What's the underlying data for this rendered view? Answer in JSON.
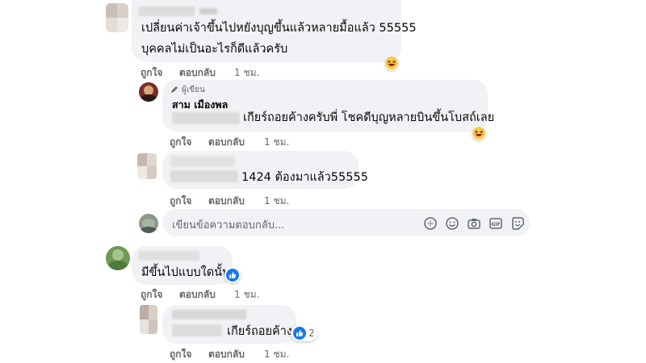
{
  "comments": [
    {
      "text_line1": "เปลี่ยนค่าเจ้าขึ้นไปหยังบุญขึ้นแล้วหลายมื้อแล้ว 55555",
      "text_line2": "บุคคลไม่เป็นอะไรก็ดีแล้วครับ",
      "reaction": "laughing-emoji",
      "actions": {
        "like": "ถูกใจ",
        "reply": "ตอบกลับ",
        "time": "1 ชม."
      }
    },
    {
      "author_badge": "ผู้เขียน",
      "author_name": "สาม เมืองพล",
      "text_line1": "เกียร์ถอยค้างครับพี่ โชคดีบุญหลายบินขึ้นโบสถ์เลย",
      "reaction": "laughing-emoji",
      "actions": {
        "like": "ถูกใจ",
        "reply": "ตอบกลับ",
        "time": "1 ชม."
      }
    },
    {
      "text_line1": "1424 ต้องมาแล้ว55555",
      "actions": {
        "like": "ถูกใจ",
        "reply": "ตอบกลับ",
        "time": "1 ชม."
      }
    },
    {
      "text_line1": "มีขึ้นไปแบบใดนั้น",
      "reaction": "like",
      "actions": {
        "like": "ถูกใจ",
        "reply": "ตอบกลับ",
        "time": "1 ชม."
      }
    },
    {
      "text_line1": "เกียร์ถอยค้าง",
      "reaction": "like",
      "reaction_count": "2",
      "actions": {
        "like": "ถูกใจ",
        "reply": "ตอบกลับ",
        "time": "1 ชม."
      }
    }
  ],
  "composer": {
    "placeholder": "เขียนข้อความตอบกลับ...",
    "icons": [
      "sticker-icon",
      "emoji-icon",
      "camera-icon",
      "gif-icon",
      "avatar-sticker-icon"
    ]
  },
  "colors": {
    "bubble": "#f0f2f5",
    "secondary_text": "#65676b",
    "like_blue": "#1877f2",
    "emoji_yellow": "#f7c84a"
  }
}
